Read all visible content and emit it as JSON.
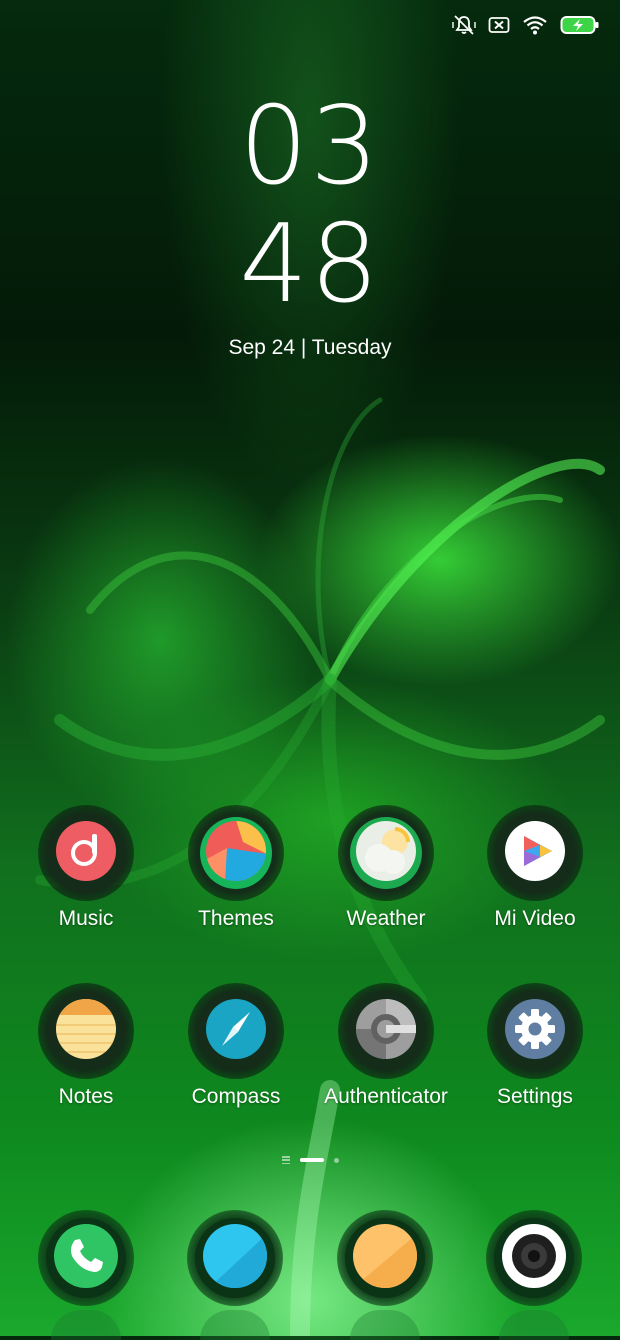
{
  "status_bar": {
    "icons": [
      "vibrate-mute-icon",
      "no-sim-icon",
      "wifi-icon",
      "battery-charging-icon"
    ]
  },
  "lockscreen_clock": {
    "hours": "03",
    "minutes": "48",
    "date": "Sep 24 | Tuesday"
  },
  "home": {
    "apps_row1": [
      {
        "label": "Music",
        "icon": "music-icon"
      },
      {
        "label": "Themes",
        "icon": "themes-icon"
      },
      {
        "label": "Weather",
        "icon": "weather-icon"
      },
      {
        "label": "Mi Video",
        "icon": "mi-video-icon"
      }
    ],
    "apps_row2": [
      {
        "label": "Notes",
        "icon": "notes-icon"
      },
      {
        "label": "Compass",
        "icon": "compass-icon"
      },
      {
        "label": "Authenticator",
        "icon": "authenticator-icon"
      },
      {
        "label": "Settings",
        "icon": "settings-icon"
      }
    ],
    "page_indicator": {
      "pages": 2,
      "current": 1
    }
  },
  "dock": {
    "icons": [
      "phone-icon",
      "messaging-icon",
      "browser-icon",
      "camera-icon"
    ]
  },
  "colors": {
    "music": "#ef5d64",
    "compass": "#1aa5c4",
    "settings": "#5f7ea1",
    "notes": "#f4c864",
    "phone": "#2fc565",
    "messaging": "#2ec5ef",
    "browser": "#fdc26a"
  }
}
